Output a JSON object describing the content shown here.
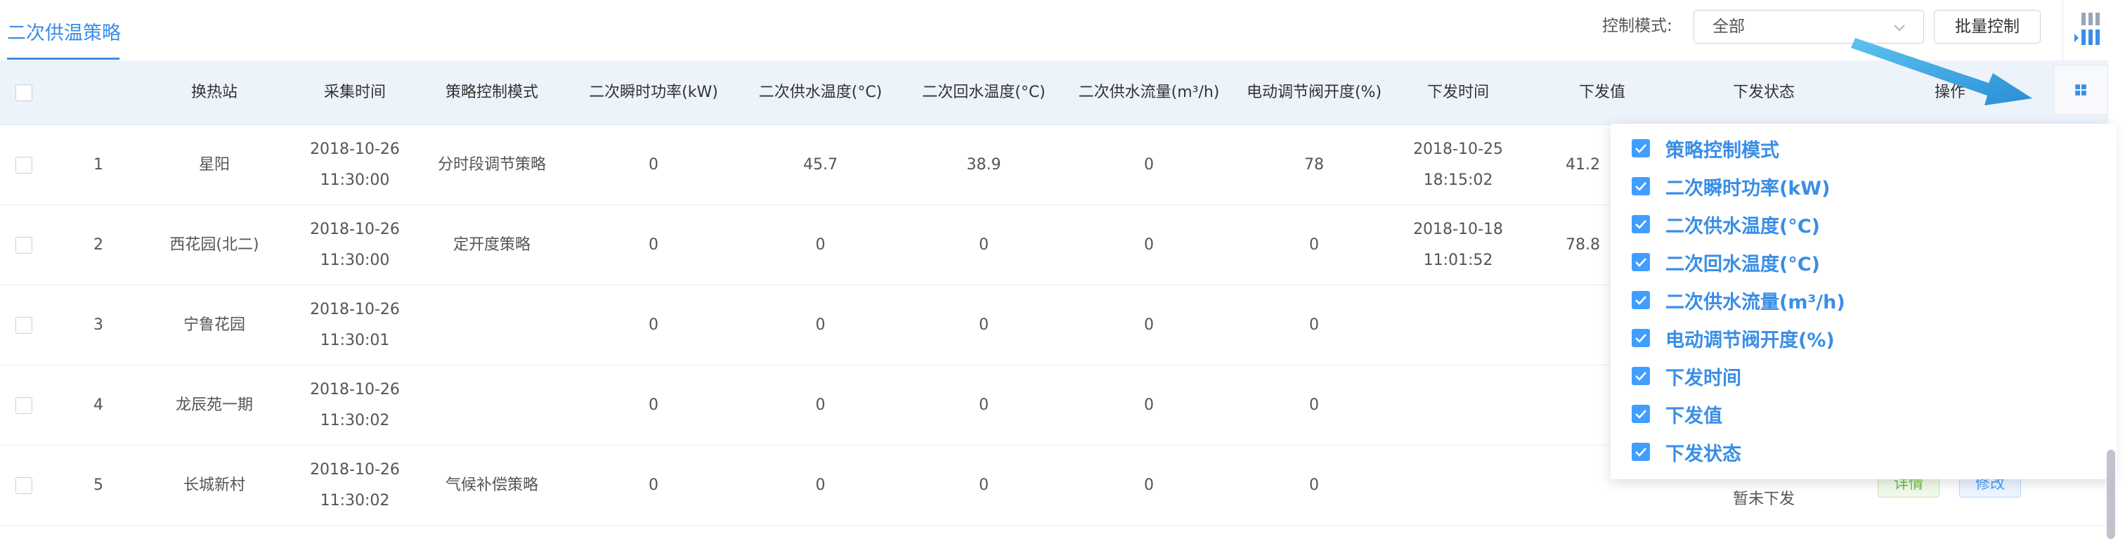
{
  "tab": {
    "label": "二次供温策略"
  },
  "toolbar": {
    "mode_label": "控制模式:",
    "mode_value": "全部",
    "batch_label": "批量控制"
  },
  "table": {
    "headers": {
      "station": "换热站",
      "collect_time": "采集时间",
      "strategy_mode": "策略控制模式",
      "power": "二次瞬时功率(kW)",
      "supply_temp": "二次供水温度(°C)",
      "return_temp": "二次回水温度(°C)",
      "flow": "二次供水流量(m³/h)",
      "valve": "电动调节阀开度(%)",
      "send_time": "下发时间",
      "send_value": "下发值",
      "send_status": "下发状态",
      "action": "操作"
    },
    "rows": [
      {
        "index": "1",
        "station": "星阳",
        "collect_time": "2018-10-26 11:30:00",
        "strategy_mode": "分时段调节策略",
        "power": "0",
        "supply_temp": "45.7",
        "return_temp": "38.9",
        "flow": "0",
        "valve": "78",
        "send_time": "2018-10-25 18:15:02",
        "send_value": "41.2"
      },
      {
        "index": "2",
        "station": "西花园(北二)",
        "collect_time": "2018-10-26 11:30:00",
        "strategy_mode": "定开度策略",
        "power": "0",
        "supply_temp": "0",
        "return_temp": "0",
        "flow": "0",
        "valve": "0",
        "send_time": "2018-10-18 11:01:52",
        "send_value": "78.8"
      },
      {
        "index": "3",
        "station": "宁鲁花园",
        "collect_time": "2018-10-26 11:30:01",
        "strategy_mode": "",
        "power": "0",
        "supply_temp": "0",
        "return_temp": "0",
        "flow": "0",
        "valve": "0",
        "send_time": "",
        "send_value": ""
      },
      {
        "index": "4",
        "station": "龙辰苑一期",
        "collect_time": "2018-10-26 11:30:02",
        "strategy_mode": "",
        "power": "0",
        "supply_temp": "0",
        "return_temp": "0",
        "flow": "0",
        "valve": "0",
        "send_time": "",
        "send_value": ""
      },
      {
        "index": "5",
        "station": "长城新村",
        "collect_time": "2018-10-26 11:30:02",
        "strategy_mode": "气候补偿策略",
        "power": "0",
        "supply_temp": "0",
        "return_temp": "0",
        "flow": "0",
        "valve": "0",
        "send_time": "",
        "send_value": ""
      }
    ],
    "row5_status": "暂未下发",
    "row5_actions": {
      "detail": "详情",
      "edit": "修改"
    }
  },
  "column_popover": {
    "items": [
      "策略控制模式",
      "二次瞬时功率(kW)",
      "二次供水温度(°C)",
      "二次回水温度(°C)",
      "二次供水流量(m³/h)",
      "电动调节阀开度(%)",
      "下发时间",
      "下发值",
      "下发状态"
    ]
  },
  "colors": {
    "accent": "#3a8ee6",
    "checkbox_checked": "#409eff",
    "header_bg": "#edf3fb",
    "arrow": "#3aa6e0"
  },
  "icons": {
    "select_arrow": "chevron-down-icon",
    "column_toggle": "columns-icon",
    "grid": "grid-icon",
    "check": "check-icon",
    "pointer_arrow": "arrow-annotation-icon"
  }
}
